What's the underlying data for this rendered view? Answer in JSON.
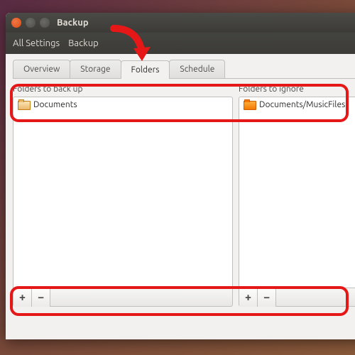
{
  "window": {
    "title": "Backup"
  },
  "toolbar": {
    "all_settings": "All Settings",
    "backup": "Backup"
  },
  "tabs": {
    "overview": "Overview",
    "storage": "Storage",
    "folders": "Folders",
    "schedule": "Schedule"
  },
  "panels": {
    "backup_label": "Folders to back up",
    "ignore_label": "Folders to ignore",
    "backup_items": [
      {
        "name": "Documents"
      }
    ],
    "ignore_items": [
      {
        "name": "Documents/MusicFiles"
      }
    ]
  },
  "buttons": {
    "add": "+",
    "remove": "−"
  }
}
